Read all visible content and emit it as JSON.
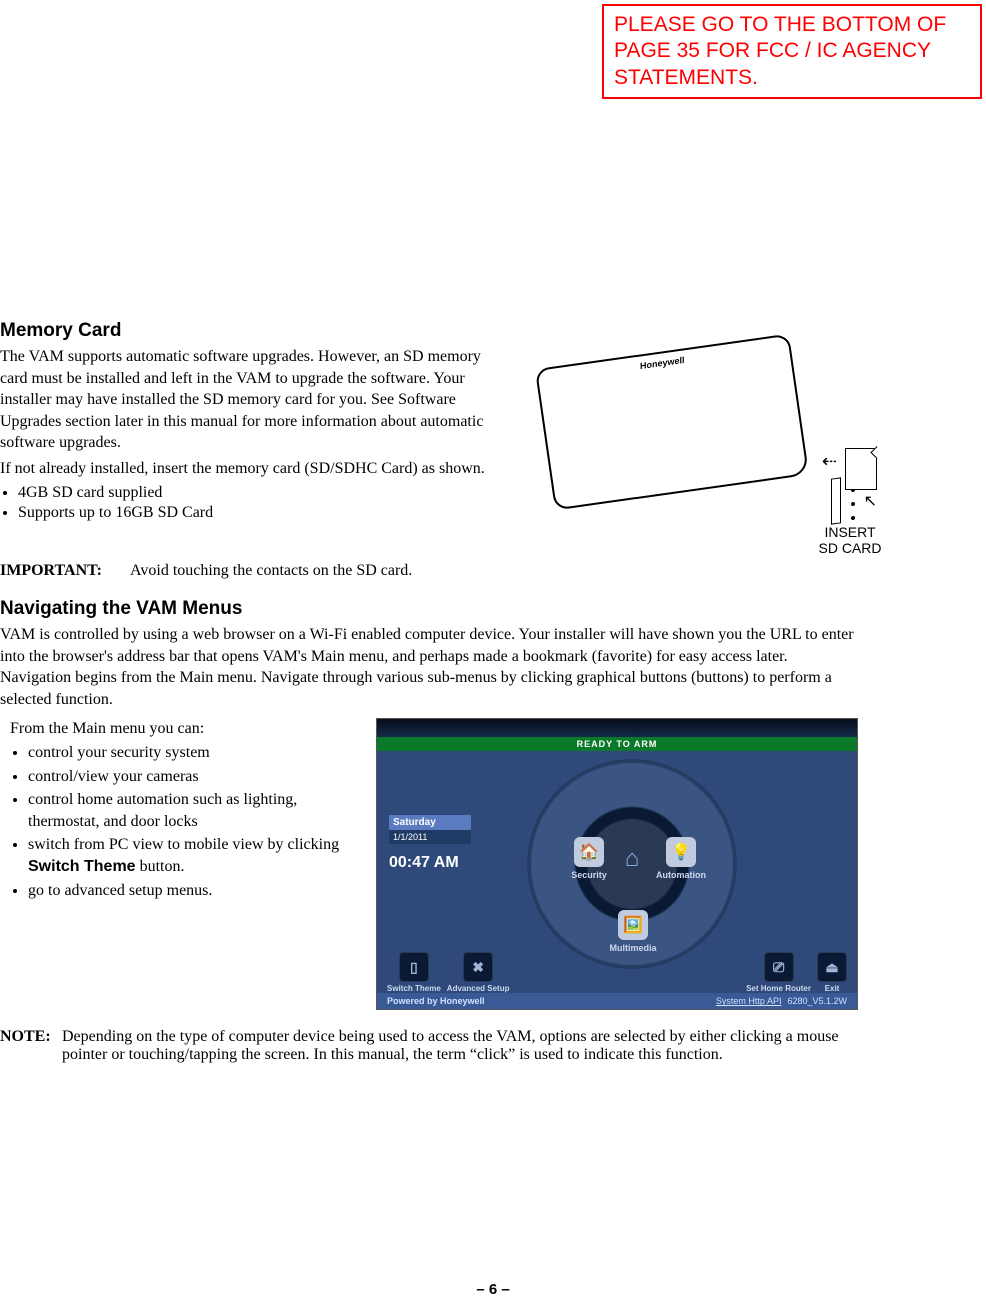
{
  "notice": "PLEASE GO TO THE BOTTOM OF PAGE 35 FOR FCC / IC AGENCY STATEMENTS.",
  "mem": {
    "heading": "Memory Card",
    "p1": "The VAM supports automatic software upgrades. However, an SD memory card must be installed and left in the VAM to upgrade the software. Your installer may have installed the SD memory card for you. See Software Upgrades section later in this manual for more information about automatic software upgrades.",
    "p2": "If not already installed, insert the memory card (SD/SDHC Card) as shown.",
    "b1": "4GB SD card supplied",
    "b2": "Supports up to 16GB SD Card"
  },
  "device": {
    "logo": "Honeywell",
    "caption1": "INSERT",
    "caption2": "SD CARD"
  },
  "important": {
    "label": "IMPORTANT:",
    "text": "Avoid touching the contacts on the SD card."
  },
  "nav": {
    "heading": "Navigating the VAM Menus",
    "intro": "VAM is controlled by using a web browser on a Wi-Fi enabled computer device. Your installer will have shown you the URL to enter into the browser's address bar that opens VAM's Main menu, and perhaps made a bookmark (favorite) for easy access later. Navigation begins from the Main menu. Navigate through various sub-menus by clicking graphical buttons (buttons) to perform a selected function.",
    "lead": "From the Main menu you can:",
    "items": {
      "i0": "control your security system",
      "i1": "control/view your cameras",
      "i2": "control home automation such as lighting, thermostat, and door locks",
      "i3a": "switch from PC view to mobile view by clicking ",
      "i3b": "Switch Theme",
      "i3c": " button.",
      "i4": "go to advanced setup menus."
    }
  },
  "menu": {
    "ready": "READY TO ARM",
    "day": "Saturday",
    "date": "1/1/2011",
    "time": "00:47 AM",
    "security": "Security",
    "automation": "Automation",
    "multimedia": "Multimedia",
    "switch_theme": "Switch Theme",
    "advanced_setup": "Advanced Setup",
    "set_home_router": "Set Home Router",
    "exit": "Exit",
    "powered": "Powered by Honeywell",
    "api": "System Http API",
    "version": "6280_V5.1.2W"
  },
  "note": {
    "label": "NOTE:",
    "text": "Depending on the type of computer device being used to access the VAM, options are selected by either clicking a mouse pointer or touching/tapping the screen. In this manual, the term “click” is used to indicate this function."
  },
  "page_number": "– 6 –"
}
